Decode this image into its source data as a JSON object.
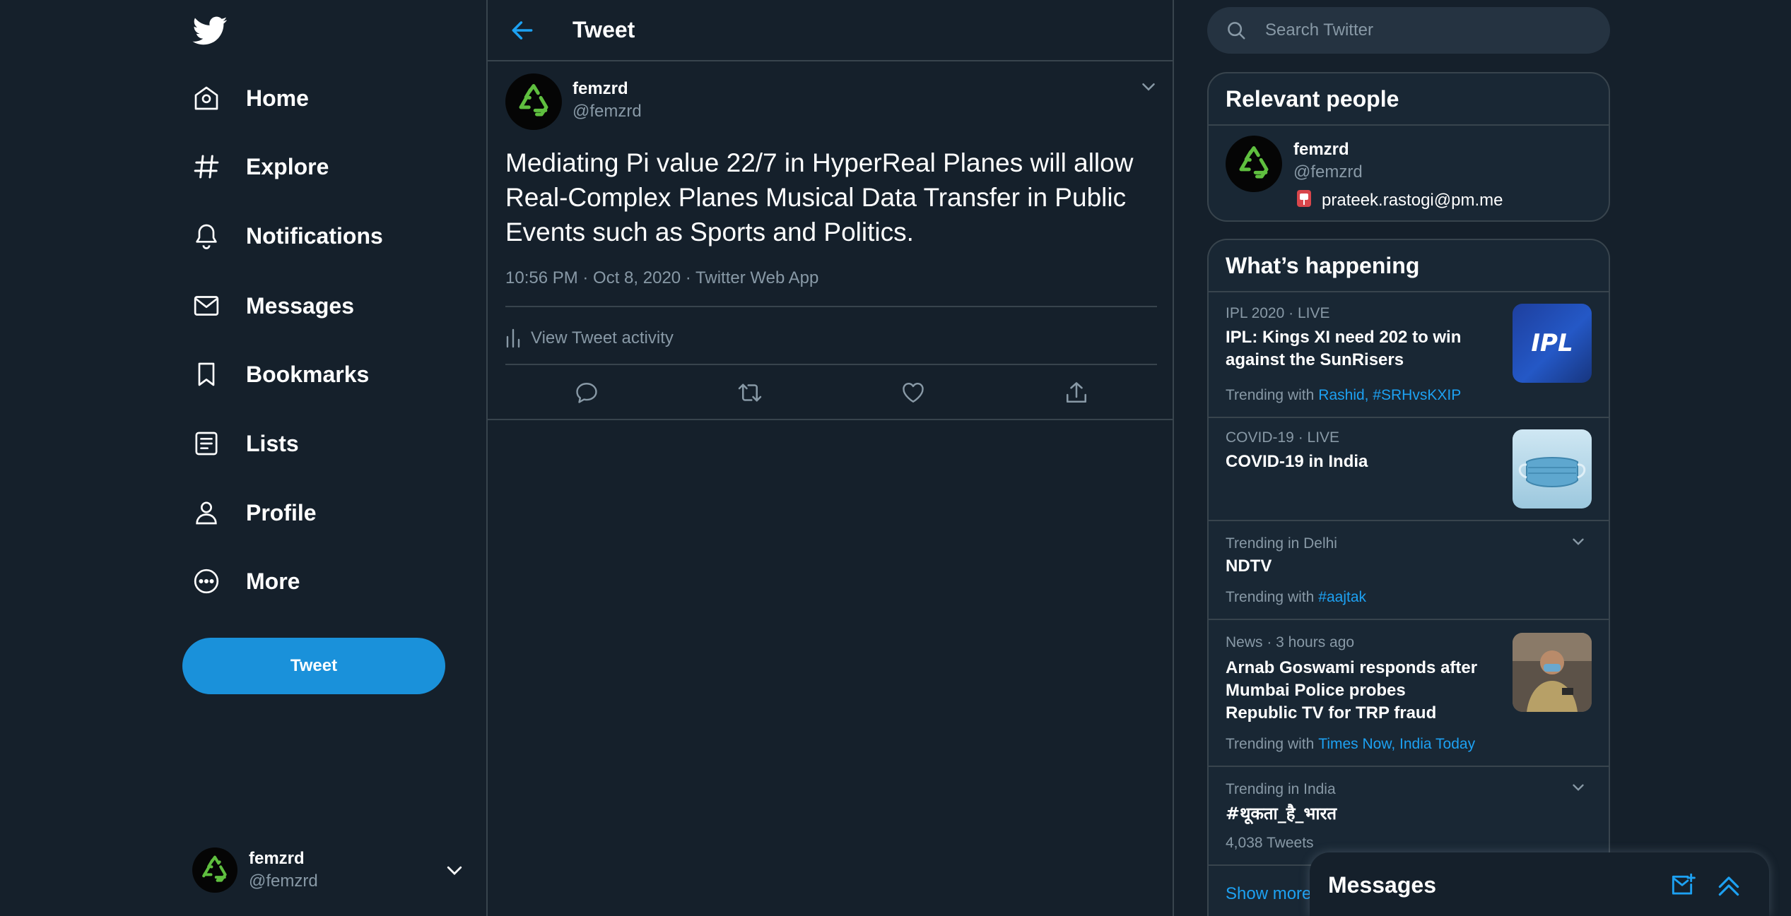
{
  "colors": {
    "accent": "#1da1f2",
    "background": "#15202b",
    "border": "#38444d",
    "muted": "#8899a6",
    "button": "#1a91da",
    "panel": "#192734"
  },
  "nav": {
    "logo_icon": "twitter-bird-icon",
    "items": [
      {
        "label": "Home",
        "icon": "home-icon"
      },
      {
        "label": "Explore",
        "icon": "hashtag-icon"
      },
      {
        "label": "Notifications",
        "icon": "bell-icon"
      },
      {
        "label": "Messages",
        "icon": "envelope-icon"
      },
      {
        "label": "Bookmarks",
        "icon": "bookmark-icon"
      },
      {
        "label": "Lists",
        "icon": "list-icon"
      },
      {
        "label": "Profile",
        "icon": "person-icon"
      },
      {
        "label": "More",
        "icon": "more-circle-icon"
      }
    ],
    "tweet_button": "Tweet",
    "account": {
      "name": "femzrd",
      "handle": "@femzrd"
    }
  },
  "header": {
    "title": "Tweet"
  },
  "tweet": {
    "author_name": "femzrd",
    "author_handle": "@femzrd",
    "text": "Mediating Pi value 22/7 in HyperReal Planes will allow Real-Complex Planes Musical Data Transfer in Public Events such as Sports and Politics.",
    "meta": "10:56 PM · Oct 8, 2020 · Twitter Web App",
    "activity_label": "View Tweet activity"
  },
  "search": {
    "placeholder": "Search Twitter"
  },
  "relevant_people": {
    "title": "Relevant people",
    "person": {
      "name": "femzrd",
      "handle": "@femzrd",
      "email": "prateek.rastogi@pm.me"
    }
  },
  "whats_happening": {
    "title": "What’s happening",
    "trends": [
      {
        "meta": "IPL 2020 · LIVE",
        "title": "IPL: Kings XI need 202 to win against the SunRisers",
        "with_label": "Trending with",
        "with_links": "Rashid, #SRHvsKXIP",
        "thumb_text": "IPL"
      },
      {
        "meta": "COVID-19 · LIVE",
        "title": "COVID-19 in India"
      },
      {
        "meta": "Trending in Delhi",
        "title": "NDTV",
        "with_label": "Trending with",
        "with_links": "#aajtak"
      },
      {
        "meta": "News · 3 hours ago",
        "title": "Arnab Goswami responds after Mumbai Police probes Republic TV for TRP fraud",
        "with_label": "Trending with",
        "with_links": "Times Now, India Today"
      },
      {
        "meta": "Trending in India",
        "title": "#थूकता_है_भारत",
        "count": "4,038 Tweets"
      }
    ],
    "show_more": "Show more"
  },
  "messages_drawer": {
    "title": "Messages"
  }
}
